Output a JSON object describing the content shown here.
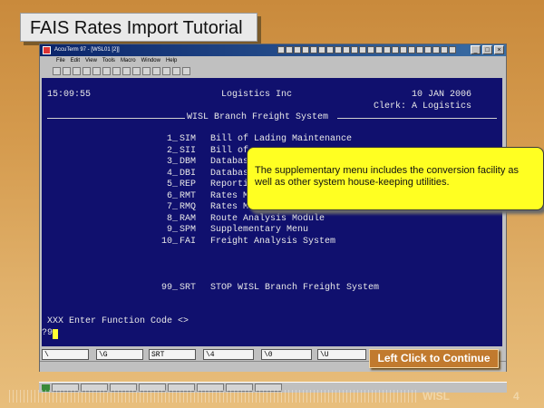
{
  "slide": {
    "title": "FAIS Rates Import Tutorial",
    "footer_brand": "WISL",
    "page_number": "4",
    "continue_label": "Left Click to Continue",
    "callout_text": "The supplementary menu includes the conversion facility as well as other system house-keeping utilities."
  },
  "window": {
    "title": "AccuTerm 97 - [WSL01 [2]]",
    "menu": [
      "File",
      "Edit",
      "View",
      "Tools",
      "Macro",
      "Window",
      "Help"
    ]
  },
  "terminal": {
    "time": "15:09:55",
    "company": "Logistics Inc",
    "date": "10 JAN 2006",
    "clerk": "Clerk: A Logistics",
    "system_title": "WISL Branch Freight System",
    "menu_items": [
      {
        "num": "1_",
        "code": "SIM",
        "label": "Bill of Lading Maintenance"
      },
      {
        "num": "2_",
        "code": "SII",
        "label": "Bill of"
      },
      {
        "num": "3_",
        "code": "DBM",
        "label": "Databas"
      },
      {
        "num": "4_",
        "code": "DBI",
        "label": "Databas"
      },
      {
        "num": "5_",
        "code": "REP",
        "label": "Reporti"
      },
      {
        "num": "6_",
        "code": "RMT",
        "label": "Rates M"
      },
      {
        "num": "7_",
        "code": "RMQ",
        "label": "Rates M"
      },
      {
        "num": "8_",
        "code": "RAM",
        "label": "Route Analysis Module"
      },
      {
        "num": "9_",
        "code": "SPM",
        "label": "Supplementary Menu"
      },
      {
        "num": "10_",
        "code": "FAI",
        "label": "Freight Analysis System"
      }
    ],
    "stop_item": {
      "num": "99_",
      "code": "SRT",
      "label": "STOP WISL Branch Freight System"
    },
    "prompt": "XXX Enter Function Code <>",
    "input_value": "?9"
  },
  "function_keys": [
    "\\",
    "\\G",
    "SRT",
    "\\4",
    "\\0",
    "\\U"
  ]
}
